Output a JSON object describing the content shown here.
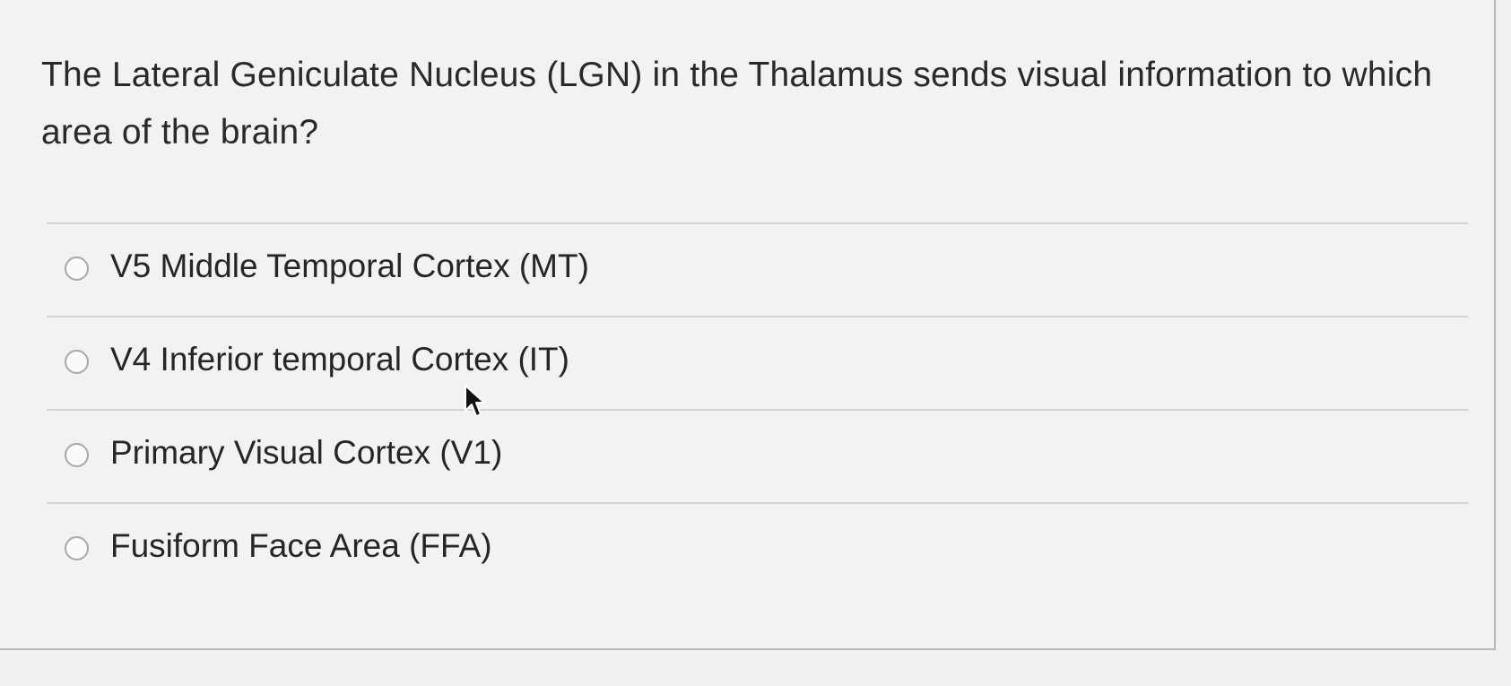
{
  "question": {
    "text": "The Lateral Geniculate Nucleus (LGN) in the Thalamus sends visual information to which area of the brain?"
  },
  "answers": [
    {
      "label": "V5 Middle Temporal Cortex (MT)",
      "selected": false
    },
    {
      "label": "V4 Inferior temporal Cortex (IT)",
      "selected": false
    },
    {
      "label": "Primary Visual Cortex (V1)",
      "selected": false
    },
    {
      "label": "Fusiform Face Area (FFA)",
      "selected": false
    }
  ],
  "cursor": {
    "icon": "mouse-pointer-icon"
  }
}
